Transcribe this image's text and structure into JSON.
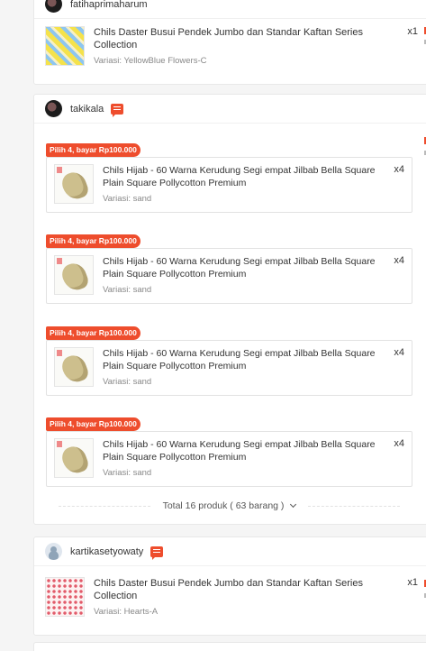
{
  "orders": [
    {
      "shop": "fatihaprimaharum",
      "items": [
        {
          "name": "Chils Daster Busui Pendek Jumbo dan Standar Kaftan Series Collection",
          "variant": "Variasi: YellowBlue Flowers-C",
          "qty": "x1",
          "thumb_icon": "dress-photo"
        }
      ]
    },
    {
      "shop": "takikala",
      "bundle_tag": "Pilih 4, bayar Rp100.000",
      "items": [
        {
          "name": "Chils Hijab - 60 Warna Kerudung Segi empat Jilbab Bella Square Plain Square Pollycotton Premium",
          "variant": "Variasi: sand",
          "qty": "x4"
        },
        {
          "name": "Chils Hijab - 60 Warna Kerudung Segi empat Jilbab Bella Square Plain Square Pollycotton Premium",
          "variant": "Variasi: sand",
          "qty": "x4"
        },
        {
          "name": "Chils Hijab - 60 Warna Kerudung Segi empat Jilbab Bella Square Plain Square Pollycotton Premium",
          "variant": "Variasi: sand",
          "qty": "x4"
        },
        {
          "name": "Chils Hijab - 60 Warna Kerudung Segi empat Jilbab Bella Square Plain Square Pollycotton Premium",
          "variant": "Variasi: sand",
          "qty": "x4"
        }
      ],
      "total": "Total 16 produk ( 63 barang )"
    },
    {
      "shop": "kartikasetyowaty",
      "items": [
        {
          "name": "Chils Daster Busui Pendek Jumbo dan Standar Kaftan Series Collection",
          "variant": "Variasi: Hearts-A",
          "qty": "x1"
        }
      ]
    }
  ],
  "colors": {
    "accent": "#ee4d2d",
    "background": "#f5f5f5",
    "card": "#ffffff"
  }
}
